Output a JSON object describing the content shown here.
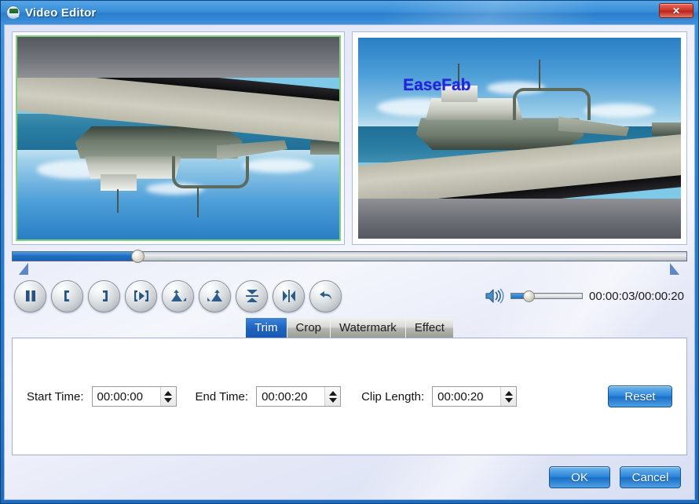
{
  "window": {
    "title": "Video Editor",
    "icon": "app-icon",
    "close_label": "✕",
    "accent_color": "#1f6fc4",
    "titlebar_color": "#3a8fd8",
    "close_color": "#d0392c"
  },
  "previews": {
    "left": {
      "name": "source-preview",
      "watermark": "",
      "selected": true,
      "border_color": "#7fd07f",
      "flipped": true
    },
    "right": {
      "name": "output-preview",
      "watermark": "EaseFab",
      "watermark_color": "#2323dd",
      "selected": false,
      "flipped": false
    }
  },
  "seek": {
    "progress_percent": 18.5,
    "trim_start_marker": "left-trim-handle",
    "trim_end_marker": "right-trim-handle"
  },
  "toolbar": {
    "buttons": [
      {
        "name": "pause-button",
        "icon": "pause-icon",
        "title": "Pause"
      },
      {
        "name": "set-start-button",
        "icon": "bracket-left-icon",
        "title": "Set Start"
      },
      {
        "name": "set-end-button",
        "icon": "bracket-right-icon",
        "title": "Set End"
      },
      {
        "name": "play-segment-button",
        "icon": "play-bracket-icon",
        "title": "Play Segment"
      },
      {
        "name": "rotate-left-button",
        "icon": "rotate-left-icon",
        "title": "Rotate Left"
      },
      {
        "name": "rotate-right-button",
        "icon": "rotate-right-icon",
        "title": "Rotate Right"
      },
      {
        "name": "flip-vertical-button",
        "icon": "flip-vertical-icon",
        "title": "Flip Vertical"
      },
      {
        "name": "flip-horizontal-button",
        "icon": "flip-horizontal-icon",
        "title": "Flip Horizontal"
      },
      {
        "name": "undo-button",
        "icon": "undo-arrow-icon",
        "title": "Undo"
      }
    ]
  },
  "volume": {
    "icon": "speaker-icon",
    "level_percent": 24
  },
  "time": {
    "current": "00:00:03",
    "total": "00:00:20",
    "display": "00:00:03/00:00:20"
  },
  "tabs": [
    {
      "label": "Trim",
      "active": true
    },
    {
      "label": "Crop",
      "active": false
    },
    {
      "label": "Watermark",
      "active": false
    },
    {
      "label": "Effect",
      "active": false
    }
  ],
  "trim_panel": {
    "start_time": {
      "label": "Start Time:",
      "value": "00:00:00"
    },
    "end_time": {
      "label": "End Time:",
      "value": "00:00:20"
    },
    "clip_length": {
      "label": "Clip Length:",
      "value": "00:00:20"
    },
    "reset_label": "Reset"
  },
  "footer": {
    "ok_label": "OK",
    "cancel_label": "Cancel"
  }
}
